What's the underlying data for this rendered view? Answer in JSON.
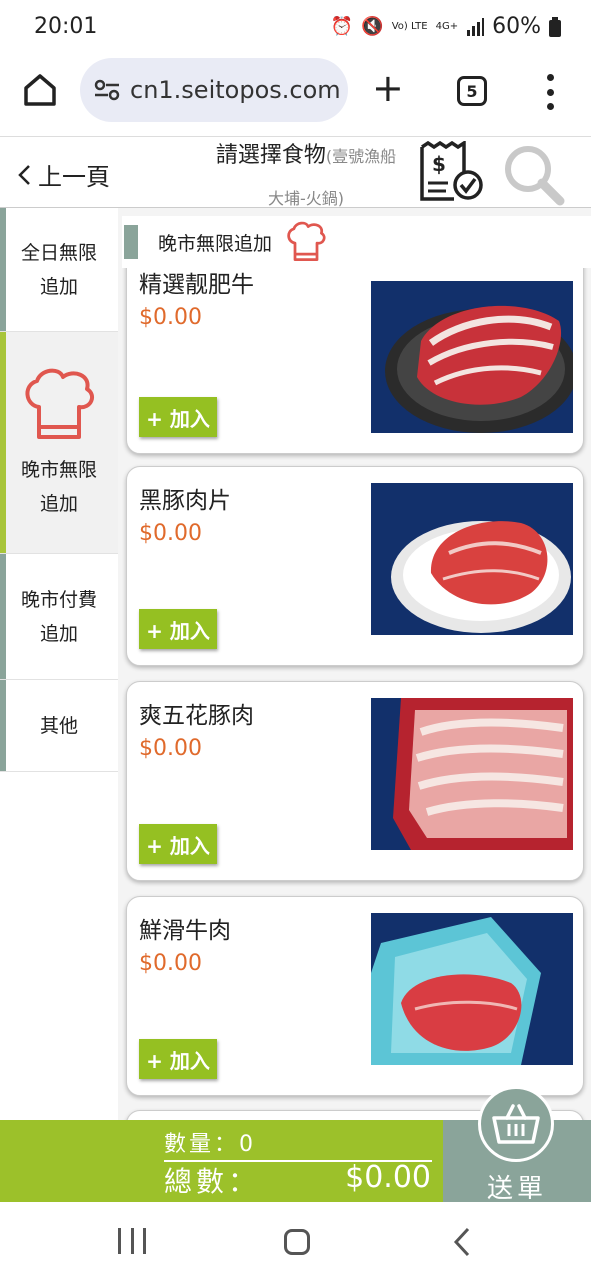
{
  "status_bar": {
    "time": "20:01",
    "battery": "60%",
    "icons": [
      "alarm-icon",
      "mute-icon",
      "volte-icon",
      "4g-icon",
      "signal-icon",
      "battery-icon"
    ],
    "volte_label": "Vo) LTE",
    "network_label": "4G+"
  },
  "browser": {
    "url": "cn1.seitopos.com",
    "tab_count": "5"
  },
  "header": {
    "back_label": "上一頁",
    "title": "請選擇食物",
    "title_sub": "(壹號漁船",
    "title_line2": "大埔-火鍋)"
  },
  "sidebar": {
    "items": [
      {
        "label_1": "全日無限",
        "label_2": "追加",
        "active": false
      },
      {
        "label_1": "晚市無限",
        "label_2": "追加",
        "active": true
      },
      {
        "label_1": "晚市付費",
        "label_2": "追加",
        "active": false
      },
      {
        "label_1": "其他",
        "label_2": "",
        "active": false
      }
    ]
  },
  "section": {
    "title": "晚市無限追加"
  },
  "products": [
    {
      "name": "精選靓肥牛",
      "price": "$0.00",
      "add_label": "+ 加入",
      "photo": "marbled-beef-plate"
    },
    {
      "name": "黑豚肉片",
      "price": "$0.00",
      "add_label": "+ 加入",
      "photo": "pork-slices-plate"
    },
    {
      "name": "爽五花豚肉",
      "price": "$0.00",
      "add_label": "+ 加入",
      "photo": "pork-belly-tray"
    },
    {
      "name": "鮮滑牛肉",
      "price": "$0.00",
      "add_label": "+ 加入",
      "photo": "beef-blue-tray"
    }
  ],
  "cart": {
    "qty_label": "數量：0",
    "total_label": "總數：",
    "total": "$0.00",
    "submit_label": "送單"
  },
  "colors": {
    "accent_green": "#9cc12a",
    "accent_gray_green": "#8aa49a",
    "price_orange": "#e06a2c",
    "hat_red": "#e0574f"
  }
}
